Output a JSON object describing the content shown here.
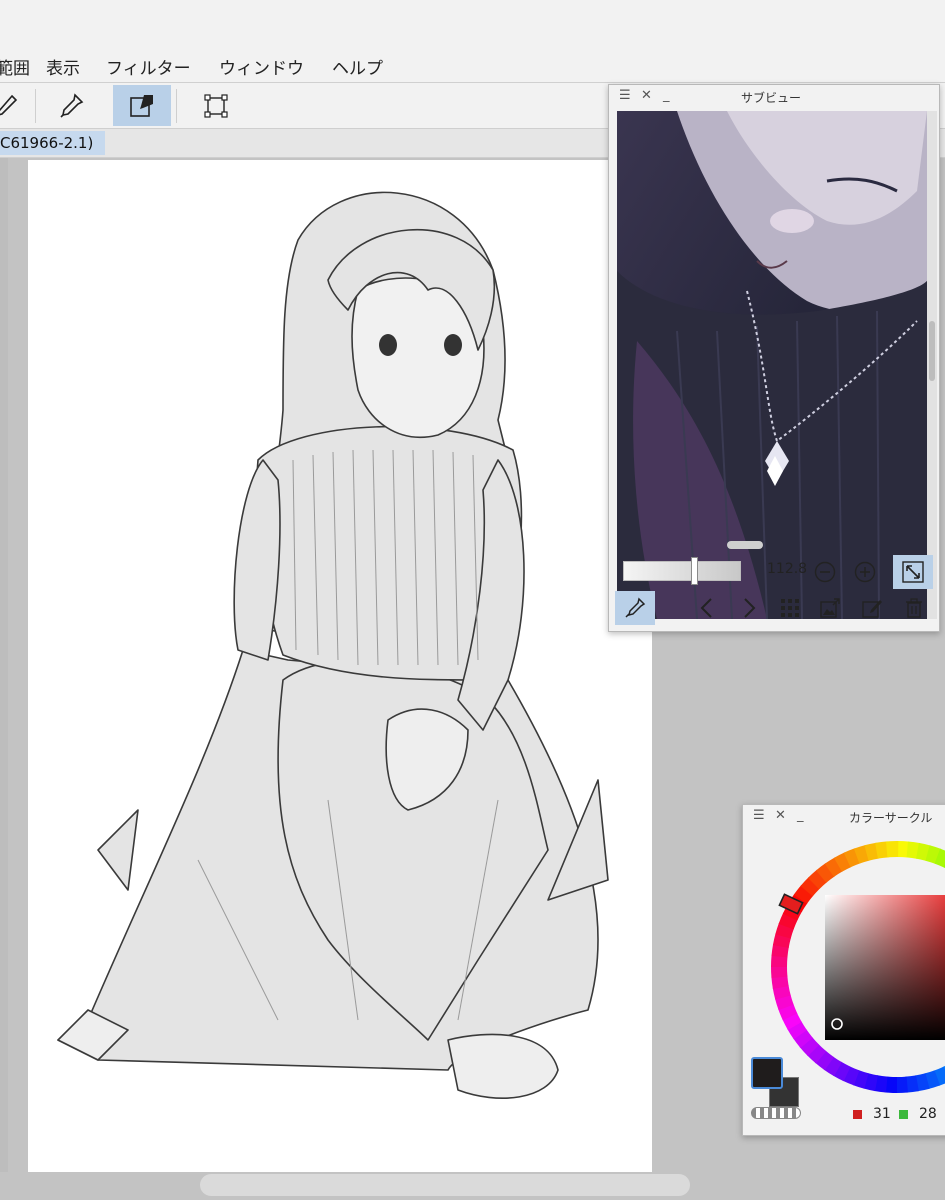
{
  "menu": {
    "items": [
      "範囲",
      "表示",
      "フィルター",
      "ウィンドウ",
      "ヘルプ"
    ]
  },
  "document": {
    "tab_label": "C61966-2.1)"
  },
  "subview": {
    "title": "サブビュー",
    "zoom_value": "112.8",
    "zoom_slider_level": 0.6
  },
  "color_circle": {
    "title": "カラーサークル",
    "red_value": "31",
    "green_value": "28",
    "primary_color": "#1f1c1c",
    "secondary_color": "#333333",
    "hue_color": "#e41e1e"
  },
  "icons": {
    "subview_eyedropper": "eyedropper-icon",
    "prev": "chevron-left-icon",
    "next": "chevron-right-icon",
    "grid": "grid-icon",
    "import": "image-import-icon",
    "edit": "edit-icon",
    "delete": "trash-icon",
    "zoom_out": "minus-circle-icon",
    "zoom_in": "plus-circle-icon",
    "fit": "fit-window-icon"
  }
}
